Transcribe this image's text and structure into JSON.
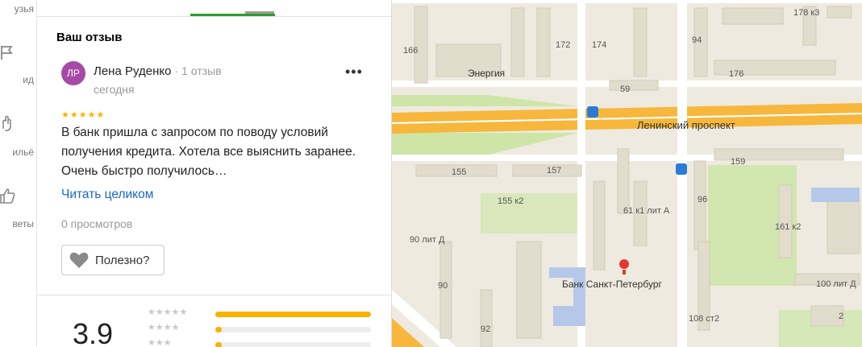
{
  "rail": {
    "items": [
      {
        "label": "узья"
      },
      {
        "label": "ид"
      },
      {
        "label": "ильё"
      },
      {
        "label": "веты"
      }
    ]
  },
  "review_section": {
    "title": "Ваш отзыв",
    "author": {
      "initials": "ЛР",
      "name": "Лена Руденко",
      "meta": "· 1 отзыв",
      "date": "сегодня"
    },
    "stars": "★★★★★",
    "rating_value": 5,
    "more_label": "•••",
    "text": "В банк пришла с запросом по поводу условий получения кредита. Хотела все выяснить заранее. Очень быстро получилось…",
    "read_more": "Читать целиком",
    "views": "0 просмотров",
    "useful_label": "Полезно?"
  },
  "rating_summary": {
    "average": "3.9",
    "distribution": [
      {
        "stars": "★★★★★",
        "fraction": 1.0
      },
      {
        "stars": "★★★★",
        "fraction": 0.04
      },
      {
        "stars": "★★★",
        "fraction": 0.04
      }
    ]
  },
  "map": {
    "labels": {
      "b166": "166",
      "b172": "172",
      "b174": "174",
      "b94": "94",
      "b178k3": "178 к3",
      "energia": "Энергия",
      "b176": "176",
      "b59": "59",
      "street": "Ленинский проспект",
      "b155": "155",
      "b157": "157",
      "b159": "159",
      "b155k2": "155 к2",
      "b96": "96",
      "b61k1": "61 к1 лит А",
      "b161k2": "161 к2",
      "b90litd": "90 лит Д",
      "bank": "Банк Санкт-Петербург",
      "b100": "100 лит Д",
      "b90": "90",
      "b108": "108 ст2",
      "b2": "2",
      "b92": "92"
    }
  }
}
